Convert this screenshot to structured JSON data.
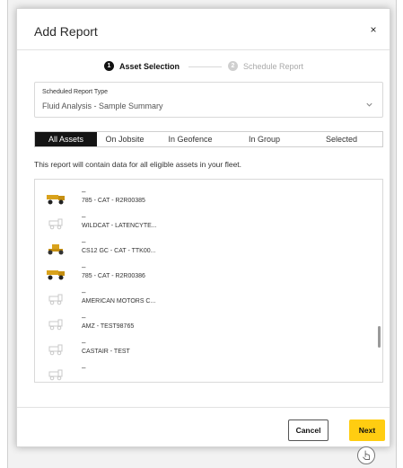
{
  "dialog": {
    "title": "Add Report",
    "close_glyph": "×"
  },
  "stepper": {
    "steps": [
      {
        "number": "1",
        "label": "Asset Selection",
        "state": "active"
      },
      {
        "number": "2",
        "label": "Schedule Report",
        "state": "inactive"
      }
    ]
  },
  "report_type": {
    "caption": "Scheduled Report Type",
    "value": "Fluid Analysis - Sample Summary",
    "icon": "chevron-down-icon"
  },
  "tabs": [
    {
      "label": "All Assets",
      "active": true
    },
    {
      "label": "On Jobsite",
      "active": false
    },
    {
      "label": "In Geofence",
      "active": false
    },
    {
      "label": "In Group",
      "active": false
    },
    {
      "label": "Selected",
      "active": false
    }
  ],
  "description": "This report will contain data for all eligible assets in your fleet.",
  "assets": [
    {
      "serial": "–",
      "name": "785 - CAT - R2R00385",
      "thumb": "haul-truck-icon"
    },
    {
      "serial": "–",
      "name": "WILDCAT - LATENCYTE...",
      "thumb": "generic-machine-icon"
    },
    {
      "serial": "–",
      "name": "CS12 GC - CAT - TTK00...",
      "thumb": "roller-icon"
    },
    {
      "serial": "–",
      "name": "785 - CAT - R2R00386",
      "thumb": "haul-truck-icon"
    },
    {
      "serial": "–",
      "name": "AMERICAN MOTORS C...",
      "thumb": "generic-machine-icon"
    },
    {
      "serial": "–",
      "name": "AMZ - TEST98765",
      "thumb": "generic-machine-icon"
    },
    {
      "serial": "–",
      "name": "CASTAIR - TEST",
      "thumb": "generic-machine-icon"
    },
    {
      "serial": "–",
      "name": "",
      "thumb": "generic-machine-icon"
    }
  ],
  "footer": {
    "cancel_label": "Cancel",
    "next_label": "Next"
  },
  "colors": {
    "accent": "#ffcd11",
    "active_tab": "#141414",
    "machine_yellow": "#d9a21b"
  }
}
